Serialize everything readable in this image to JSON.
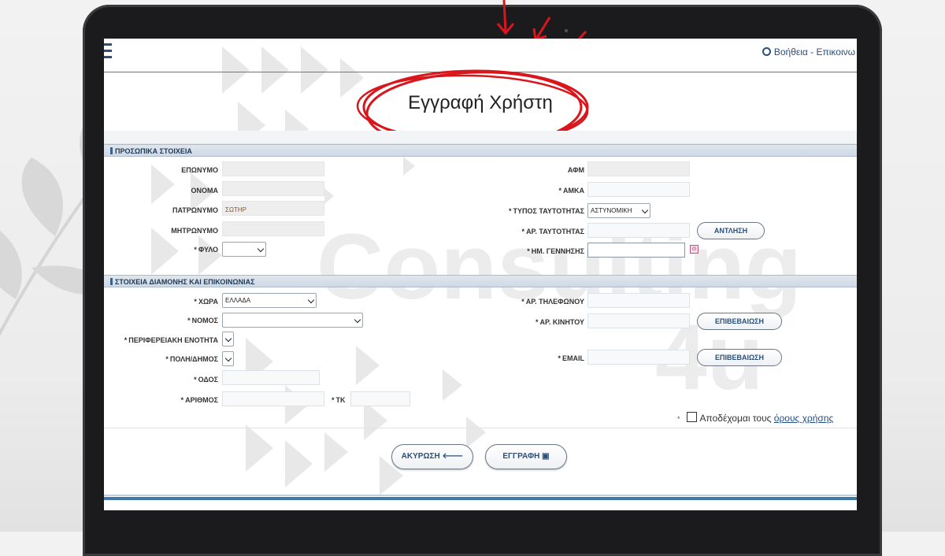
{
  "header": {
    "help_link": "Βοήθεια - Επικοινω"
  },
  "page_title": "Εγγραφή Χρήστη",
  "watermark": {
    "line1": "Consulting",
    "line2": "4u"
  },
  "personal": {
    "section_title": "ΠΡΟΣΩΠΙΚΑ ΣΤΟΙΧΕΙΑ",
    "surname_label": "ΕΠΩΝΥΜΟ",
    "name_label": "ΟΝΟΜΑ",
    "father_label": "ΠΑΤΡΩΝΥΜΟ",
    "father_value": "ΣΩΤΗΡ",
    "mother_label": "ΜΗΤΡΩΝΥΜΟ",
    "gender_label": "ΦΥΛΟ",
    "afm_label": "ΑΦΜ",
    "amka_label": "ΑΜΚΑ",
    "id_type_label": "ΤΥΠΟΣ ΤΑΥΤΟΤΗΤΑΣ",
    "id_type_value": "ΑΣΤΥΝΟΜΙΚΗ",
    "id_number_label": "ΑΡ. ΤΑΥΤΟΤΗΤΑΣ",
    "retrieve_button": "ΑΝΤΛΗΣΗ",
    "birth_date_label": "ΗΜ. ΓΕΝΝΗΣΗΣ"
  },
  "residence": {
    "section_title": "ΣΤΟΙΧΕΙΑ ΔΙΑΜΟΝΗΣ ΚΑΙ ΕΠΙΚΟΙΝΩΝΙΑΣ",
    "country_label": "ΧΩΡΑ",
    "country_value": "ΕΛΛΑΔΑ",
    "prefecture_label": "ΝΟΜΟΣ",
    "regional_unit_label": "ΠΕΡΙΦΕΡΕΙΑΚΗ ΕΝΟΤΗΤΑ",
    "city_label": "ΠΟΛΗ/ΔΗΜΟΣ",
    "street_label": "ΟΔΟΣ",
    "number_label": "ΑΡΙΘΜΟΣ",
    "postal_label": "ΤΚ",
    "phone_label": "ΑΡ. ΤΗΛΕΦΩΝΟΥ",
    "mobile_label": "ΑΡ. ΚΙΝΗΤΟΥ",
    "confirm_mobile_button": "ΕΠΙΒΕΒΑΙΩΣΗ",
    "email_label": "EMAIL",
    "confirm_email_button": "ΕΠΙΒΕΒΑΙΩΣΗ"
  },
  "terms": {
    "prefix": "Αποδέχομαι τους",
    "link": "όρους χρήσης"
  },
  "actions": {
    "cancel": "ΑΚΥΡΩΣΗ",
    "register": "ΕΓΓΡΑΦΗ"
  },
  "colors": {
    "accent": "#2a4f7a",
    "section_bar": "#d5dee8",
    "annotation_red": "#d9161c"
  }
}
